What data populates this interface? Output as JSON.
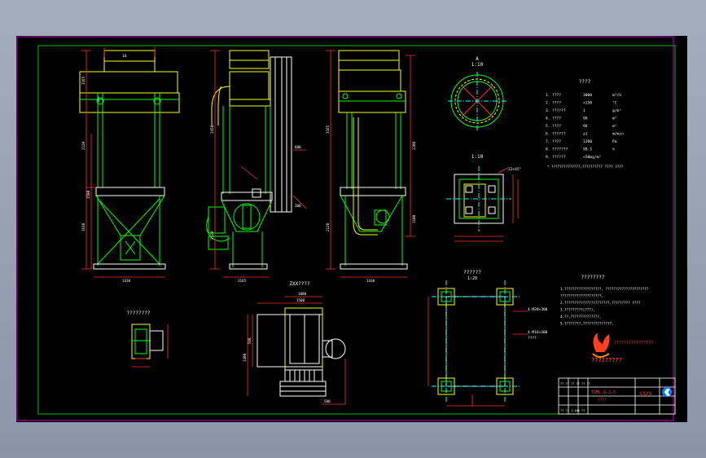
{
  "colors": {
    "viewport_bg": "#94a0b2",
    "sheet_bg": "#000000",
    "outer_border": "#c000c0",
    "inner_border": "#00c000",
    "geometry": "#00ff00",
    "dimension": "#ff3030",
    "outline": "#ffffff",
    "hidden": "#ffff00",
    "center": "#00ffff",
    "logo_red": "#ff4020"
  },
  "icons": {
    "logo": "flame-logo-icon",
    "company_badge": "company-badge-icon"
  },
  "views": {
    "front": {
      "label_top": "10"
    },
    "section_top": {
      "ratio": "1:10",
      "label": "A"
    },
    "plan_top": {
      "label": "1:10",
      "dim_top": "22×45°"
    },
    "foundation": {
      "label": "1:20"
    }
  },
  "labels": {
    "front_dims": [
      "1430",
      "1630",
      "2120",
      "3165",
      "1500"
    ],
    "side_dims": [
      "2450",
      "2120",
      "3165",
      "600",
      "300"
    ],
    "right_dims": [
      "1430",
      "2120",
      "3165",
      "2200",
      "1100"
    ],
    "bottom_mid_view_title": "ZXX????",
    "bottom_left_view_title": "????????",
    "bottom_mid_dims": [
      "1500",
      "1000",
      "1400",
      "560",
      "500"
    ],
    "foundation_title": "??????",
    "foundation_notes": [
      "4-M20×300",
      "4-M16×300",
      "????"
    ],
    "tech_title": "????",
    "tech_rows": [
      {
        "n": "1",
        "k": "????",
        "v": "3000",
        "u": "m³/h"
      },
      {
        "n": "2",
        "k": "????",
        "v": "<150",
        "u": "°C"
      },
      {
        "n": "3",
        "k": "??????",
        "v": "1",
        "u": "g/m³"
      },
      {
        "n": "4",
        "k": "????",
        "v": "96",
        "u": "m²"
      },
      {
        "n": "5",
        "k": "????",
        "v": "96",
        "u": "m²"
      },
      {
        "n": "6",
        "k": "??????",
        "v": "≤1",
        "u": "m/min"
      },
      {
        "n": "7",
        "k": "????",
        "v": "1200",
        "u": "Pa"
      },
      {
        "n": "8",
        "k": "???????",
        "v": "99.5",
        "u": "%"
      },
      {
        "n": "9",
        "k": "??????",
        "v": "<50mg/m³",
        "u": ""
      }
    ],
    "tech_footnote": "* ??????????????,??????????   ????  ????",
    "notes_title": "????????",
    "notes": [
      "1.??????????????????,  ?????????????????????",
      "  ????????????????????,",
      "2.??????????????????????,?????????     ????",
      "3.?????????(???),",
      "4.??,??????????????,",
      "5.????????,??????????????,"
    ],
    "company_name": "?????????",
    "company_url": "????????????????"
  },
  "title_block": {
    "drawing_no": "TDMC-8-2-5",
    "drawing_name": "????",
    "code": "CSYX",
    "rows": [
      "?? ?? ?? ?? ?? ??",
      "?? ?? ?? ??",
      "??",
      "?? ?? 1:100 ??"
    ]
  }
}
